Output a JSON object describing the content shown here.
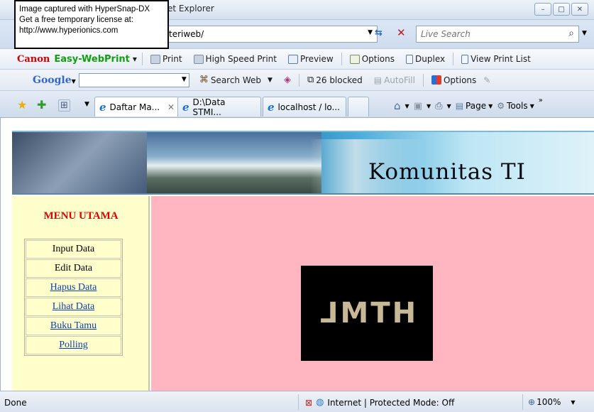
{
  "window": {
    "title_partial": "et Explorer",
    "minimize": "–",
    "maximize": "□",
    "close": "✕"
  },
  "overlay": {
    "line1": "Image captured with HyperSnap-DX",
    "line2": "Get a free temporary license at:",
    "line3": "http://www.hyperionics.com"
  },
  "address_bar": {
    "url_partial": "teriweb/",
    "search_placeholder": "Live Search"
  },
  "canon_toolbar": {
    "brand": "Canon",
    "product": "Easy-WebPrint",
    "print": "Print",
    "high_speed_print": "High Speed Print",
    "preview": "Preview",
    "options": "Options",
    "duplex": "Duplex",
    "view_print_list": "View Print List"
  },
  "google_toolbar": {
    "logo": "Google",
    "search_web": "Search Web",
    "blocked": "26 blocked",
    "autofill": "AutoFill",
    "options": "Options"
  },
  "tabs": [
    {
      "label": "Daftar Ma...",
      "active": true
    },
    {
      "label": "D:\\Data STMI...",
      "active": false
    },
    {
      "label": "localhost / lo...",
      "active": false
    }
  ],
  "command_bar": {
    "page": "Page",
    "tools": "Tools"
  },
  "page": {
    "banner_text": "Komunitas TI",
    "menu_title": "MENU UTAMA",
    "menu_items": [
      {
        "label": "Input Data",
        "link": false
      },
      {
        "label": "Edit Data",
        "link": false
      },
      {
        "label": "Hapus Data",
        "link": true
      },
      {
        "label": "Lihat Data",
        "link": true
      },
      {
        "label": "Buku Tamu",
        "link": true
      },
      {
        "label": "Polling",
        "link": true
      }
    ],
    "image_text": "HTML",
    "main_bg": "#ffb6c1",
    "sidebar_bg": "#ffffcc"
  },
  "status_bar": {
    "status": "Done",
    "zone": "Internet | Protected Mode: Off",
    "zoom": "100%"
  }
}
